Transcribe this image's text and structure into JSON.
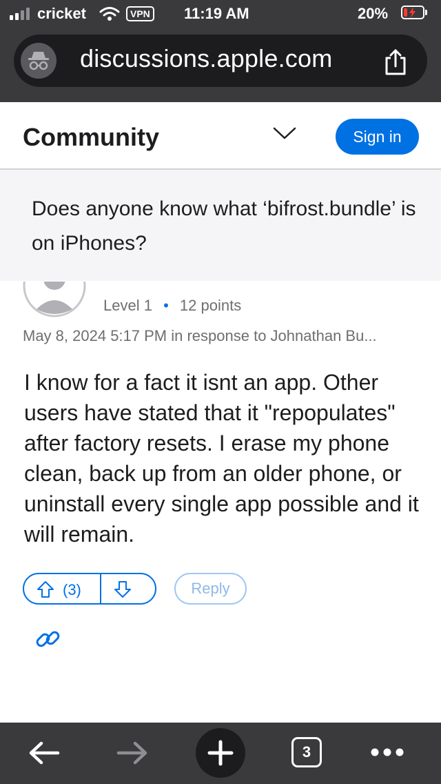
{
  "status_bar": {
    "carrier": "cricket",
    "vpn": "VPN",
    "time": "11:19 AM",
    "battery": "20%",
    "battery_level": 0.2
  },
  "browser": {
    "url": "discussions.apple.com",
    "tab_count": "3"
  },
  "header": {
    "title": "Community",
    "sign_in_label": "Sign in"
  },
  "question": {
    "title": "Does anyone know what ‘bifrost.bundle’ is on iPhones?"
  },
  "reply": {
    "author_level": "Level 1",
    "points": "12 points",
    "date": "May 8, 2024 5:17 PM in response to Johnathan Bu...",
    "body": "I know for a fact it isnt an app. Other users have stated that it \"repopulates\" after factory resets. I erase my phone clean, back up from an older phone, or uninstall every single app possible and it will remain.",
    "vote_count": "(3)",
    "reply_label": "Reply"
  },
  "colors": {
    "accent": "#0071e3",
    "chrome": "#3a3a3c",
    "battery_low": "#ff3b30"
  },
  "icons": [
    "signal-icon",
    "wifi-icon",
    "battery-icon",
    "incognito-icon",
    "share-icon",
    "chevron-down-icon",
    "avatar-icon",
    "upvote-icon",
    "downvote-icon",
    "link-icon",
    "back-icon",
    "forward-icon",
    "plus-icon",
    "tabs-icon",
    "more-icon"
  ]
}
